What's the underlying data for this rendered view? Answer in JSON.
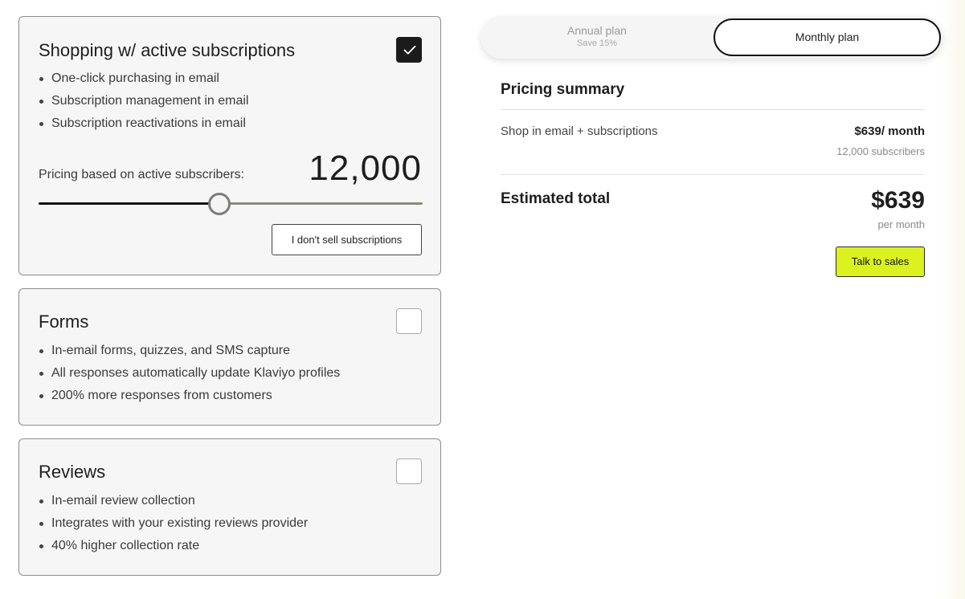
{
  "cards": {
    "shopping": {
      "title": "Shopping w/ active subscriptions",
      "checked": true,
      "bullets": [
        "One-click purchasing in email",
        "Subscription management in email",
        "Subscription reactivations in email"
      ],
      "subscribers_label": "Pricing based on active subscribers:",
      "subscribers_display": "12,000",
      "slider_position_fraction": 0.47,
      "no_subscriptions_button": "I don't sell subscriptions"
    },
    "forms": {
      "title": "Forms",
      "checked": false,
      "bullets": [
        "In-email forms, quizzes, and SMS capture",
        "All responses automatically update Klaviyo profiles",
        "200% more responses from customers"
      ]
    },
    "reviews": {
      "title": "Reviews",
      "checked": false,
      "bullets": [
        "In-email review collection",
        "Integrates with your existing reviews provider",
        "40% higher collection rate"
      ]
    }
  },
  "plan_toggle": {
    "annual_label": "Annual plan",
    "annual_save": "Save 15%",
    "monthly_label": "Monthly plan",
    "selected": "monthly"
  },
  "summary": {
    "title": "Pricing summary",
    "line_item": {
      "name": "Shop in email + subscriptions",
      "price": "$639/ month",
      "subscribers": "12,000 subscribers"
    },
    "total_label": "Estimated total",
    "total_amount": "$639",
    "total_period": "per month",
    "cta_label": "Talk to sales"
  },
  "colors": {
    "card_background": "#f6f6f6",
    "checkbox_checked": "#1b1b1b",
    "cta_background": "#dcf21f",
    "slider_fill": "#111111",
    "slider_track": "#8a8a80"
  }
}
